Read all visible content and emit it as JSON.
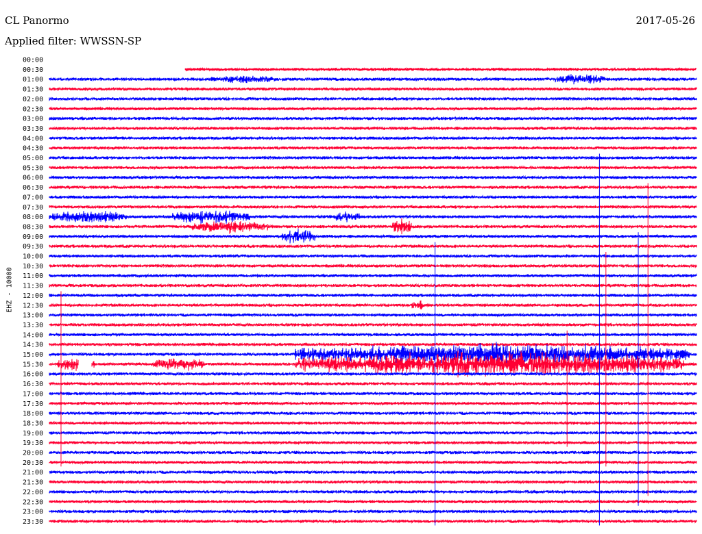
{
  "header": {
    "station": "CL Panormo",
    "date": "2017-05-26",
    "filter": "Applied filter: WWSSN-SP"
  },
  "chart_data": {
    "type": "line",
    "title": "CL Panormo",
    "subtitle": "Applied filter: WWSSN-SP",
    "ylabel": "EHZ - 10000",
    "xlabel": "",
    "colors": {
      "odd": "#ff0033",
      "even": "#0000ff"
    },
    "trace_start_row": 1,
    "trace_start_fraction": 0.21,
    "rows": [
      "00:00",
      "00:30",
      "01:00",
      "01:30",
      "02:00",
      "02:30",
      "03:00",
      "03:30",
      "04:00",
      "04:30",
      "05:00",
      "05:30",
      "06:00",
      "06:30",
      "07:00",
      "07:30",
      "08:00",
      "08:30",
      "09:00",
      "09:30",
      "10:00",
      "10:30",
      "11:00",
      "11:30",
      "12:00",
      "12:30",
      "13:00",
      "13:30",
      "14:00",
      "14:30",
      "15:00",
      "15:30",
      "16:00",
      "16:30",
      "17:00",
      "17:30",
      "18:00",
      "18:30",
      "19:00",
      "19:30",
      "20:00",
      "20:30",
      "21:00",
      "21:30",
      "22:00",
      "22:30",
      "23:00",
      "23:30"
    ],
    "events": [
      {
        "row": 2,
        "from": 0.25,
        "to": 0.35,
        "amp": 3
      },
      {
        "row": 2,
        "from": 0.78,
        "to": 0.86,
        "amp": 5
      },
      {
        "row": 16,
        "from": 0.0,
        "to": 0.12,
        "amp": 6
      },
      {
        "row": 16,
        "from": 0.19,
        "to": 0.31,
        "amp": 7
      },
      {
        "row": 16,
        "from": 0.44,
        "to": 0.48,
        "amp": 5
      },
      {
        "row": 17,
        "from": 0.22,
        "to": 0.34,
        "amp": 7
      },
      {
        "row": 17,
        "from": 0.53,
        "to": 0.56,
        "amp": 8
      },
      {
        "row": 18,
        "from": 0.36,
        "to": 0.41,
        "amp": 8
      },
      {
        "row": 25,
        "from": 0.56,
        "to": 0.58,
        "amp": 5
      },
      {
        "row": 30,
        "from": 0.38,
        "to": 0.99,
        "amp": 12
      },
      {
        "row": 31,
        "from": 0.01,
        "to": 0.07,
        "amp": 6
      },
      {
        "row": 31,
        "from": 0.16,
        "to": 0.24,
        "amp": 7
      },
      {
        "row": 31,
        "from": 0.38,
        "to": 0.98,
        "amp": 14
      }
    ],
    "gaps": [
      {
        "row": 31,
        "from": 0.045,
        "to": 0.065
      }
    ],
    "spikes": [
      {
        "x": 0.018,
        "row_from": 24,
        "row_to": 41
      },
      {
        "x": 0.596,
        "row_from": 19,
        "row_to": 47
      },
      {
        "x": 0.8,
        "row_from": 28,
        "row_to": 39
      },
      {
        "x": 0.85,
        "row_from": 10,
        "row_to": 47
      },
      {
        "x": 0.86,
        "row_from": 20,
        "row_to": 41
      },
      {
        "x": 0.91,
        "row_from": 18,
        "row_to": 45
      },
      {
        "x": 0.925,
        "row_from": 13,
        "row_to": 44
      }
    ]
  }
}
